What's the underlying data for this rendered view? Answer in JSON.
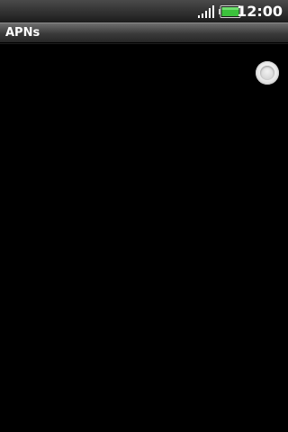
{
  "status_bar": {
    "time": "12:00",
    "signal_icon": "signal-strength-icon",
    "battery_icon": "battery-icon",
    "battery_color": "#3cc23c"
  },
  "title_bar": {
    "title": "APNs"
  },
  "apn_list": {
    "selection_icon": "radio-button-icon",
    "selected": false
  }
}
